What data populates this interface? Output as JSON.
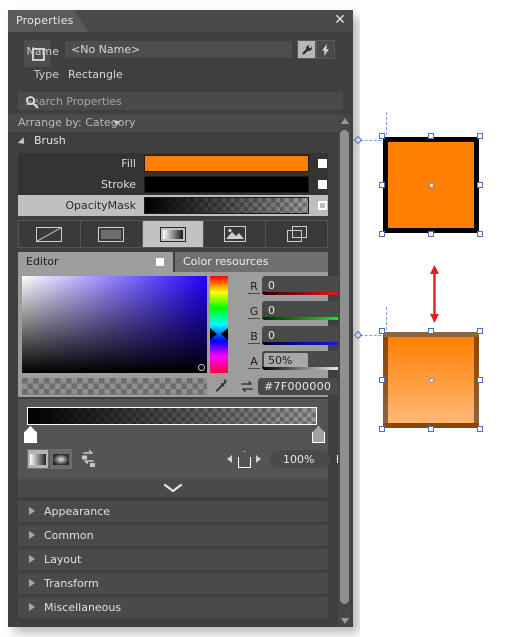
{
  "panel": {
    "tab_label": "Properties",
    "close_icon": "close-icon",
    "header": {
      "object_icon": "rectangle-icon",
      "name_label": "Name",
      "name_value": "<No Name>",
      "type_label": "Type",
      "type_value": "Rectangle",
      "wrench_icon": "wrench-icon",
      "bolt_icon": "lightning-bolt-icon"
    },
    "search": {
      "placeholder": "Search Properties",
      "value": "",
      "icon": "search-icon"
    },
    "arrange": {
      "label": "Arrange by: Category",
      "caret_icon": "chevron-down-icon"
    },
    "brush_section": {
      "title": "Brush",
      "expanded": true,
      "rows": [
        {
          "label": "Fill",
          "swatch_kind": "solid",
          "color": "#FF7F00",
          "checkbox": "filled",
          "selected": false
        },
        {
          "label": "Stroke",
          "swatch_kind": "solid",
          "color": "#000000",
          "checkbox": "filled",
          "selected": false
        },
        {
          "label": "OpacityMask",
          "swatch_kind": "gradient",
          "color": "#7F000000",
          "checkbox": "outline",
          "selected": true
        }
      ]
    },
    "brush_types": [
      {
        "name": "no-brush-icon",
        "label": "No brush",
        "active": false
      },
      {
        "name": "solid-brush-icon",
        "label": "Solid color",
        "active": false
      },
      {
        "name": "gradient-brush-icon",
        "label": "Gradient brush",
        "active": true
      },
      {
        "name": "image-brush-icon",
        "label": "Image brush",
        "active": false
      },
      {
        "name": "visual-brush-icon",
        "label": "Visual brush",
        "active": false
      }
    ],
    "editor_tabs": [
      {
        "label": "Editor",
        "active": true
      },
      {
        "label": "Color resources",
        "active": false
      }
    ],
    "color_editor": {
      "sv_picker": "saturation-value-picker",
      "hue_strip": "hue-slider",
      "channels": [
        {
          "label": "R",
          "value": "0"
        },
        {
          "label": "G",
          "value": "0"
        },
        {
          "label": "B",
          "value": "0"
        },
        {
          "label": "A",
          "value": "50%"
        }
      ],
      "eyedropper_icon": "eyedropper-icon",
      "swap_icon": "swap-colors-icon",
      "hex_value": "#7F000000"
    },
    "gradient": {
      "bar_from": "#000000",
      "bar_to": "rgba(0,0,0,0)",
      "stops": [
        {
          "position": "0%",
          "selected": true
        },
        {
          "position": "100%",
          "selected": false
        }
      ],
      "linear_icon": "linear-gradient-icon",
      "radial_icon": "radial-gradient-icon",
      "reverse_icon": "reverse-gradient-icon",
      "prev_stop_icon": "prev-stop-icon",
      "next_stop_icon": "next-stop-icon",
      "offset_value": "100%",
      "offset_checkbox": "filled"
    },
    "collapse_icon": "chevron-down-icon",
    "sections": [
      {
        "label": "Appearance",
        "expanded": false
      },
      {
        "label": "Common",
        "expanded": false
      },
      {
        "label": "Layout",
        "expanded": false
      },
      {
        "label": "Transform",
        "expanded": false
      },
      {
        "label": "Miscellaneous",
        "expanded": false
      }
    ],
    "scrollbar": {
      "up_icon": "scroll-up-icon",
      "down_icon": "scroll-down-icon"
    }
  },
  "canvas": {
    "background": "#FFFFFF",
    "shapes": [
      {
        "name": "rectangle-without-mask",
        "fill": "#FF7F00",
        "stroke": "#000000",
        "selected": true
      },
      {
        "name": "rectangle-with-opacity-mask",
        "fill": "#FF7F00",
        "stroke": "#000000",
        "selected": true
      }
    ],
    "annotation_arrow": {
      "name": "comparison-arrow",
      "color": "#E02020",
      "direction": "double-vertical"
    }
  }
}
